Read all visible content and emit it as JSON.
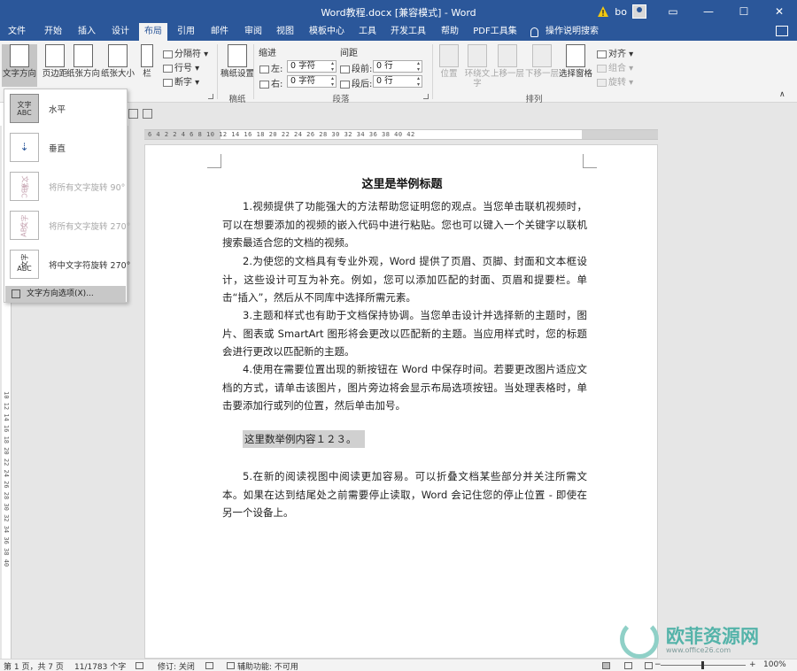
{
  "window": {
    "title": "Word教程.docx [兼容模式] - Word",
    "user": "bo",
    "controls": {
      "minimize": "—",
      "maximize": "☐",
      "close": "✕"
    }
  },
  "tabs": [
    {
      "label": "文件"
    },
    {
      "label": "开始"
    },
    {
      "label": "插入"
    },
    {
      "label": "设计"
    },
    {
      "label": "布局",
      "active": true
    },
    {
      "label": "引用"
    },
    {
      "label": "邮件"
    },
    {
      "label": "审阅"
    },
    {
      "label": "视图"
    },
    {
      "label": "模板中心"
    },
    {
      "label": "工具"
    },
    {
      "label": "开发工具"
    },
    {
      "label": "帮助"
    },
    {
      "label": "PDF工具集"
    }
  ],
  "help": {
    "label": "操作说明搜索"
  },
  "ribbon": {
    "text_direction": "文字方向",
    "margins": "页边距",
    "orientation": "纸张方向",
    "size": "纸张大小",
    "columns": "栏",
    "breaks": "分隔符",
    "line_numbers": "行号",
    "hyphenation": "断字",
    "draft_setting": "稿纸设置",
    "draft_group": "稿纸",
    "indent_label": "缩进",
    "spacing_label": "间距",
    "indent_left": "左:",
    "indent_left_value": "0 字符",
    "indent_right": "右:",
    "indent_right_value": "0 字符",
    "spacing_before": "段前:",
    "spacing_before_value": "0 行",
    "spacing_after": "段后:",
    "spacing_after_value": "0 行",
    "paragraph_group": "段落",
    "position": "位置",
    "wrap_text": "环绕文字",
    "bring_forward": "上移一层",
    "send_backward": "下移一层",
    "selection_pane": "选择窗格",
    "align": "对齐",
    "group": "组合",
    "rotate": "旋转",
    "arrange_group": "排列"
  },
  "dropdown": {
    "items": [
      {
        "thumb_top": "文字",
        "thumb_bottom": "ABC",
        "label": "水平",
        "selected": true,
        "enabled": true
      },
      {
        "thumb_top": "⇣",
        "thumb_bottom": "",
        "label": "垂直",
        "selected": false,
        "enabled": true
      },
      {
        "thumb_top": "文字",
        "thumb_bottom": "ABC",
        "label": "将所有文字旋转 90°",
        "selected": false,
        "enabled": false
      },
      {
        "thumb_top": "文字",
        "thumb_bottom": "ABC",
        "label": "将所有文字旋转 270°",
        "selected": false,
        "enabled": false
      },
      {
        "thumb_top": "文字",
        "thumb_bottom": "ABC",
        "label": "将中文字符旋转 270°",
        "selected": false,
        "enabled": true
      }
    ],
    "footer": "文字方向选项(X)..."
  },
  "ruler": {
    "h_numbers": "6 4 2 2 4 6 8 10 12 14 16 18 20 22 24 26 28 30 32 34 36 38 40 42",
    "v_numbers": "10 12 14 16 18 20 22 24 26 28 30 32 34 36 38 40"
  },
  "document": {
    "title": "这里是举例标题",
    "paragraphs": [
      "1.视频提供了功能强大的方法帮助您证明您的观点。当您单击联机视频时，可以在想要添加的视频的嵌入代码中进行粘贴。您也可以键入一个关键字以联机搜索最适合您的文档的视频。",
      "2.为使您的文档具有专业外观，Word 提供了页眉、页脚、封面和文本框设计，这些设计可互为补充。例如，您可以添加匹配的封面、页眉和提要栏。单击“插入”，然后从不同库中选择所需元素。",
      "3.主题和样式也有助于文档保持协调。当您单击设计并选择新的主题时，图片、图表或 SmartArt 图形将会更改以匹配新的主题。当应用样式时，您的标题会进行更改以匹配新的主题。",
      "4.使用在需要位置出现的新按钮在 Word 中保存时间。若要更改图片适应文档的方式，请单击该图片，图片旁边将会显示布局选项按钮。当处理表格时，单击要添加行或列的位置，然后单击加号。",
      "5.在新的阅读视图中阅读更加容易。可以折叠文档某些部分并关注所需文本。如果在达到结尾处之前需要停止读取，Word 会记住您的停止位置 - 即使在另一个设备上。"
    ],
    "highlight": "这里数举例内容１２３。"
  },
  "status": {
    "page": "第 1 页，共 7 页",
    "words": "11/1783 个字",
    "track": "修订: 关闭",
    "accessibility": "辅助功能: 不可用",
    "zoom": "100%",
    "zoom_minus": "−",
    "zoom_plus": "+"
  },
  "watermark": {
    "name": "欧菲资源网",
    "url": "www.office26.com"
  },
  "colors": {
    "accent": "#2b579a",
    "ribbon": "#f3f3f3",
    "canvas": "#e6e6e6",
    "watermark": "#54b3a9"
  }
}
